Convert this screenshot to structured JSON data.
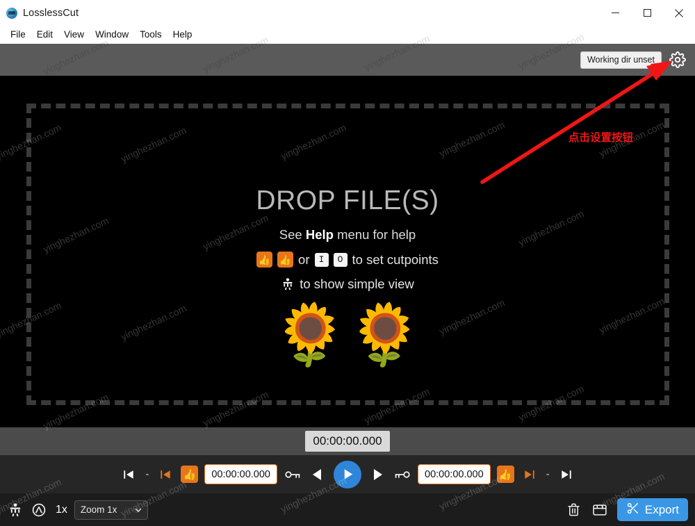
{
  "window": {
    "title": "LosslessCut",
    "app_icon": "app-logo-icon",
    "controls": {
      "minimize": "minimize-icon",
      "maximize": "maximize-icon",
      "close": "close-icon"
    }
  },
  "menubar": {
    "items": [
      {
        "label": "File"
      },
      {
        "label": "Edit"
      },
      {
        "label": "View"
      },
      {
        "label": "Window"
      },
      {
        "label": "Tools"
      },
      {
        "label": "Help"
      }
    ]
  },
  "toolbar": {
    "working_dir_label": "Working dir unset",
    "settings_icon": "gear-icon"
  },
  "stage": {
    "drop_title": "DROP FILE(S)",
    "help_prefix": "See ",
    "help_strong": "Help",
    "help_suffix": " menu for help",
    "cutpoints": {
      "or_text": "or",
      "key_in": "I",
      "key_out": "O",
      "tail_text": "to set cutpoints",
      "start_icon": "set-start-cutpoint-icon",
      "end_icon": "set-end-cutpoint-icon"
    },
    "simple_view": {
      "icon": "toggle-simple-view-icon",
      "text": "to show simple view"
    },
    "decoration": "sunflowers-emoji"
  },
  "timecode": {
    "current": "00:00:00.000"
  },
  "transport": {
    "jump_start_icon": "jump-to-timeline-start-icon",
    "prev_cut_icon": "jump-prev-cutpoint-icon",
    "set_start_icon": "set-cut-start-icon",
    "start_time": "00:00:00.000",
    "segment_icon": "segment-duration-icon",
    "step_back_icon": "step-backward-icon",
    "play_icon": "play-icon",
    "step_forward_icon": "step-forward-icon",
    "key_icon": "cut-end-key-icon",
    "end_time": "00:00:00.000",
    "set_end_icon": "set-cut-end-icon",
    "next_cut_icon": "jump-next-cutpoint-icon",
    "jump_end_icon": "jump-to-timeline-end-icon",
    "separator": "-"
  },
  "bottombar": {
    "simple_view_icon": "toggle-simple-view-icon",
    "speed_icon": "playback-rate-icon",
    "rate_label": "1x",
    "zoom_value": "Zoom 1x",
    "zoom_caret": "chevron-down-icon",
    "delete_icon": "trash-icon",
    "capture_icon": "capture-frame-icon",
    "export_icon": "scissors-icon",
    "export_label": "Export"
  },
  "annotation": {
    "text": "点击设置按钮",
    "color": "#f01616",
    "arrow": "red-arrow-pointing-to-settings"
  },
  "watermark": {
    "text": "yinghezhan.com",
    "angle_deg": -25
  },
  "colors": {
    "accent_orange": "#e8751a",
    "accent_blue": "#3a97e6",
    "play_blue": "#2f86d8",
    "toolbar_grey": "#5a5a5a",
    "stage_black": "#000000",
    "annotation_red": "#f01616"
  }
}
